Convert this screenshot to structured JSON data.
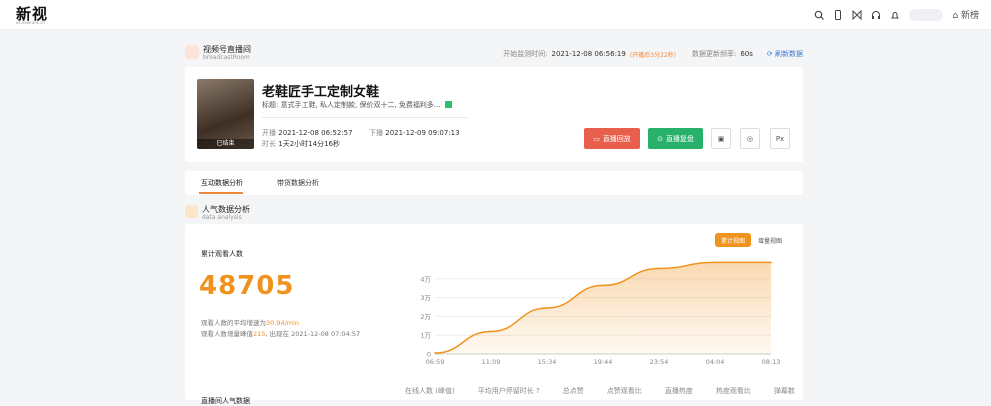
{
  "top": {
    "logo": "新视",
    "logo_sub": "xs.newrank.cn",
    "new_label": "新榜"
  },
  "breadcrumb": {
    "title": "视频号直播间",
    "subtitle": "broadcastRoom",
    "monitor_label": "开始监测时间:",
    "monitor_time": "2021-12-08 06:56:19",
    "monitor_note": "(开播后3分22秒)",
    "freq_label": "数据更新频率:",
    "freq_value": "60s",
    "refresh": "刷新数据"
  },
  "live": {
    "status": "已结束",
    "title": "老鞋匠手工定制女鞋",
    "subtitle": "标题: 意式手工鞋, 私人定制款, 保价双十二, 免费福利多...",
    "start_label": "开播",
    "start_time": "2021-12-08 06:52:57",
    "end_label": "下播",
    "end_time": "2021-12-09 09:07:13",
    "duration_label": "时长",
    "duration": "1天2小时14分16秒",
    "replay_button": "直播回放",
    "review_button": "直播复盘"
  },
  "tabs": [
    {
      "label": "互动数据分析"
    },
    {
      "label": "带货数据分析"
    }
  ],
  "section": {
    "title": "人气数据分析",
    "subtitle": "data analysis"
  },
  "panel": {
    "toggle_cumulative": "累计视图",
    "toggle_increment": "增量视图",
    "cum_label": "累计观看人数",
    "cum_value": "48705",
    "avg_text": "观看人数的平均增速为",
    "avg_value": "30.94/min",
    "peak_text": "观看人数增量峰值",
    "peak_value": "215",
    "peak_time_text": ", 出现在 2021-12-08 07:04:57",
    "bottom_label": "直播间人气数据"
  },
  "stats": [
    "在线人数 (峰值)",
    "平均用户停留时长",
    "总点赞",
    "点赞观看比",
    "直播热度",
    "热度观看比",
    "弹幕数"
  ],
  "colors": {
    "accent": "#f0931e",
    "red": "#e8604c",
    "green": "#27b16b",
    "blue": "#3a7bd5"
  },
  "chart_data": {
    "type": "area",
    "title": "",
    "xlabel": "",
    "ylabel": "",
    "x": [
      "06:59",
      "11:09",
      "15:34",
      "19:44",
      "23:54",
      "04:04",
      "08:13"
    ],
    "values": [
      500,
      12000,
      24500,
      36500,
      45500,
      48705,
      48705
    ],
    "yticks": [
      "0",
      "1万",
      "2万",
      "3万",
      "4万"
    ],
    "ylim": [
      0,
      50000
    ],
    "color": "#f0931e"
  }
}
